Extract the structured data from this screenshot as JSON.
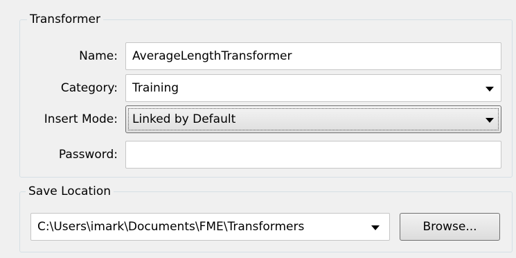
{
  "transformer_group": {
    "title": "Transformer",
    "name": {
      "label": "Name:",
      "value": "AverageLengthTransformer"
    },
    "category": {
      "label": "Category:",
      "value": "Training"
    },
    "insert_mode": {
      "label": "Insert Mode:",
      "value": "Linked by Default"
    },
    "password": {
      "label": "Password:",
      "value": ""
    }
  },
  "save_location_group": {
    "title": "Save Location",
    "path": "C:\\Users\\imark\\Documents\\FME\\Transformers",
    "browse_label": "Browse..."
  },
  "icons": {
    "dropdown": "chevron-down-icon"
  }
}
